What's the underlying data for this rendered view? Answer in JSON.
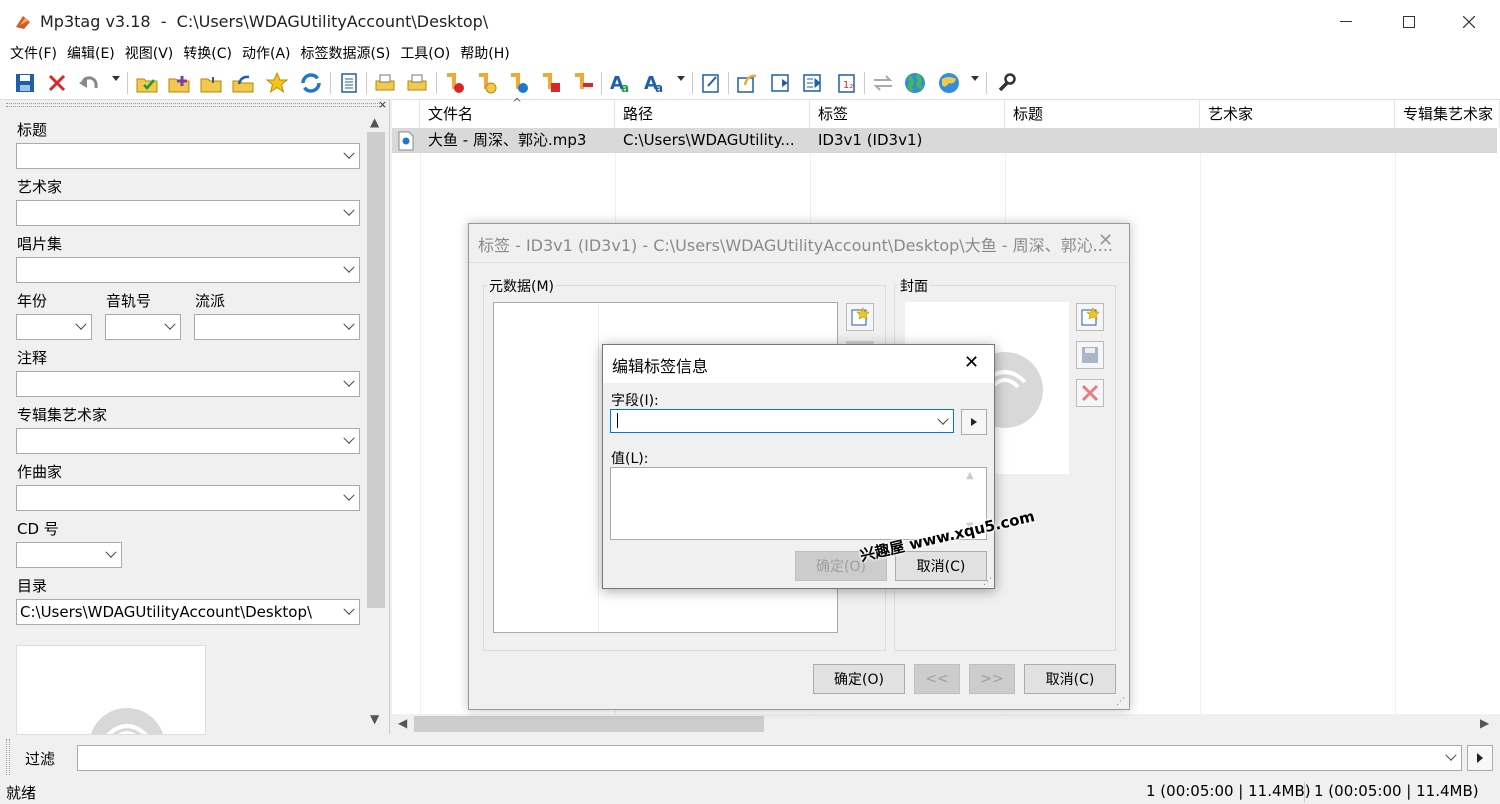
{
  "window": {
    "title": "Mp3tag v3.18  -  C:\\Users\\WDAGUtilityAccount\\Desktop\\"
  },
  "menu": [
    "文件(F)",
    "编辑(E)",
    "视图(V)",
    "转换(C)",
    "动作(A)",
    "标签数据源(S)",
    "工具(O)",
    "帮助(H)"
  ],
  "left_panel": {
    "fields": {
      "title": {
        "label": "标题",
        "value": ""
      },
      "artist": {
        "label": "艺术家",
        "value": ""
      },
      "album": {
        "label": "唱片集",
        "value": ""
      },
      "year": {
        "label": "年份",
        "value": ""
      },
      "track": {
        "label": "音轨号",
        "value": ""
      },
      "genre": {
        "label": "流派",
        "value": ""
      },
      "comment": {
        "label": "注释",
        "value": ""
      },
      "album_artist": {
        "label": "专辑集艺术家",
        "value": ""
      },
      "composer": {
        "label": "作曲家",
        "value": ""
      },
      "cd": {
        "label": "CD 号",
        "value": ""
      },
      "directory": {
        "label": "目录",
        "value": "C:\\Users\\WDAGUtilityAccount\\Desktop\\"
      }
    },
    "close_glyph": "×"
  },
  "file_list": {
    "columns": [
      "文件名",
      "路径",
      "标签",
      "标题",
      "艺术家",
      "专辑集艺术家"
    ],
    "sort_indicator": "^",
    "rows": [
      {
        "filename": "大鱼 - 周深、郭沁.mp3",
        "path": "C:\\Users\\WDAGUtility...",
        "tag": "ID3v1 (ID3v1)",
        "title": "",
        "artist": "",
        "album_artist": ""
      }
    ]
  },
  "filter": {
    "label": "过滤",
    "value": ""
  },
  "status": {
    "left": "就绪",
    "selected": "1 (00:05:00 | 11.4MB)",
    "total": "1 (00:05:00 | 11.4MB)"
  },
  "tag_dialog": {
    "title": "标签 - ID3v1 (ID3v1) - C:\\Users\\WDAGUtilityAccount\\Desktop\\大鱼 - 周深、郭沁....",
    "metadata_group": "元数据(M)",
    "cover_group": "封面",
    "ok_label": "确定(O)",
    "prev_label": "<<",
    "next_label": ">>",
    "cancel_label": "取消(C)"
  },
  "edit_dialog": {
    "title": "编辑标签信息",
    "field_label": "字段(I):",
    "field_value": "",
    "value_label": "值(L):",
    "value_text": "",
    "ok_label": "确定(O)",
    "cancel_label": "取消(C)"
  },
  "watermark": "兴趣屋 www.xqu5.com",
  "icons": [
    "save-icon",
    "delete-icon",
    "undo-icon",
    "folder-icon",
    "star-icon",
    "refresh-icon",
    "globe-icon",
    "wrench-icon"
  ],
  "colors": {
    "selection": "#d9d9d9",
    "focus": "#0078d7",
    "delete_red": "#d9262b"
  }
}
